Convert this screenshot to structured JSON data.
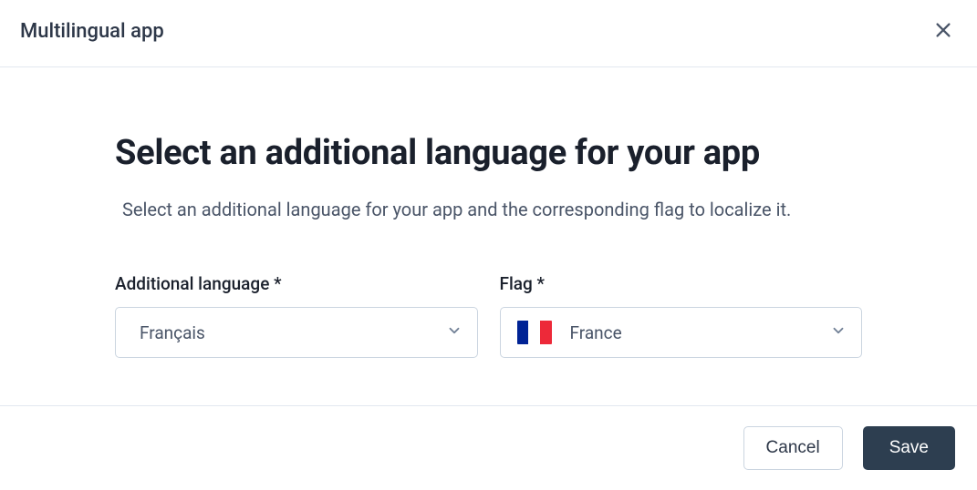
{
  "header": {
    "title": "Multilingual app"
  },
  "main": {
    "heading": "Select an additional language for your app",
    "subheading": "Select an additional language for your app and the corresponding flag to localize it."
  },
  "fields": {
    "language": {
      "label": "Additional language *",
      "value": "Français"
    },
    "flag": {
      "label": "Flag *",
      "value": "France",
      "colors": [
        "#002395",
        "#ffffff",
        "#ed2939"
      ]
    }
  },
  "footer": {
    "cancel_label": "Cancel",
    "save_label": "Save"
  }
}
